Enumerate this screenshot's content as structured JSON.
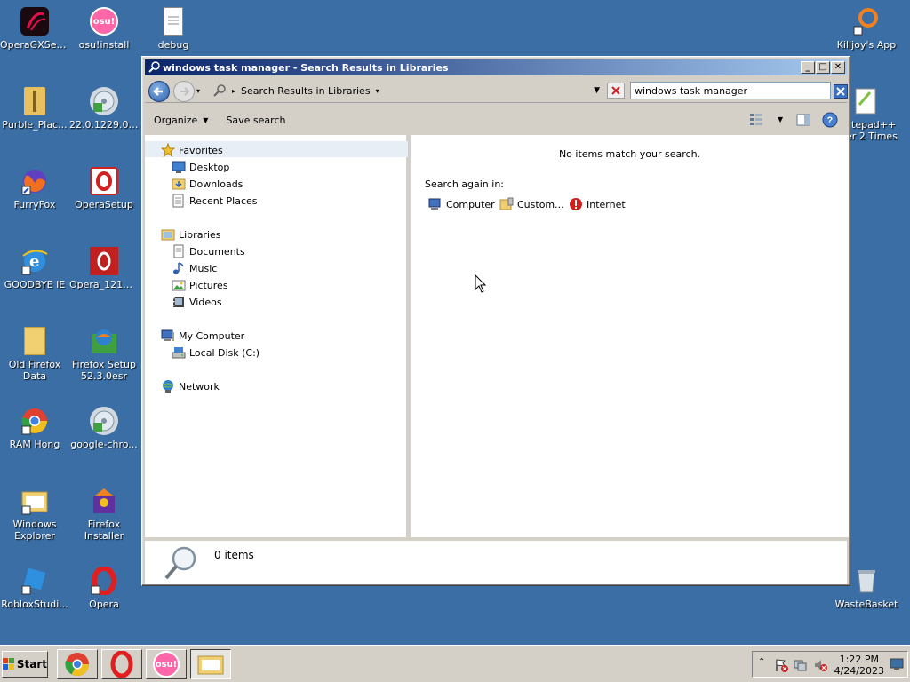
{
  "desktop": {
    "icons": [
      {
        "label": "OperaGXSetup",
        "icon": "opera-gx-icon",
        "color": "#b01030"
      },
      {
        "label": "osu!install",
        "icon": "osu-icon",
        "color": "#ff66aa"
      },
      {
        "label": "debug",
        "icon": "document-icon",
        "color": "#ffffff"
      },
      {
        "label": "Purble_Plac...",
        "icon": "zip-folder-icon",
        "color": "#e8c060"
      },
      {
        "label": "22.0.1229.0....",
        "icon": "installer-icon",
        "color": "#a0c0a0"
      },
      {
        "label": "FurryFox",
        "icon": "firefox-icon",
        "color": "#e86020"
      },
      {
        "label": "OperaSetup",
        "icon": "opera-setup-icon",
        "color": "#d02020"
      },
      {
        "label": "GOODBYE IE",
        "icon": "ie-icon",
        "color": "#2a80d0"
      },
      {
        "label": "Opera_1217....",
        "icon": "opera-package-icon",
        "color": "#c02020"
      },
      {
        "label": "Old Firefox Data",
        "icon": "folder-icon",
        "color": "#f0d070"
      },
      {
        "label": "Firefox Setup 52.3.0esr",
        "icon": "firefox-setup-icon",
        "color": "#40a040"
      },
      {
        "label": "RAM Hong",
        "icon": "chrome-icon",
        "color": "#e04030"
      },
      {
        "label": "google-chro...",
        "icon": "installer-icon",
        "color": "#a0c0a0"
      },
      {
        "label": "Windows Explorer",
        "icon": "explorer-icon",
        "color": "#f0d070"
      },
      {
        "label": "Firefox Installer",
        "icon": "firefox-installer-icon",
        "color": "#8040a0"
      },
      {
        "label": "RobloxStudi...",
        "icon": "roblox-studio-icon",
        "color": "#3090e0"
      },
      {
        "label": "Opera",
        "icon": "opera-icon",
        "color": "#e02020"
      },
      {
        "label": "Killjoy's App",
        "icon": "killjoy-icon",
        "color": "#f08020"
      },
      {
        "label": "tepad++",
        "icon": "notepadpp-icon",
        "color": "#80c040"
      },
      {
        "label": "er 2 Times",
        "icon": "",
        "color": ""
      },
      {
        "label": "WasteBasket",
        "icon": "recycle-bin-icon",
        "color": "#c0c8d0"
      }
    ]
  },
  "window": {
    "title": "windows task manager - Search Results in Libraries",
    "address": "Search Results in Libraries",
    "search_value": "windows task manager",
    "toolbar": {
      "organize": "Organize",
      "save_search": "Save search"
    },
    "nav": {
      "favorites": "Favorites",
      "favorites_items": [
        "Desktop",
        "Downloads",
        "Recent Places"
      ],
      "libraries": "Libraries",
      "libraries_items": [
        "Documents",
        "Music",
        "Pictures",
        "Videos"
      ],
      "computer": "My Computer",
      "computer_items": [
        "Local Disk (C:)"
      ],
      "network": "Network"
    },
    "content": {
      "no_items": "No items match your search.",
      "search_again": "Search again in:",
      "options": [
        "Computer",
        "Custom...",
        "Internet"
      ]
    },
    "details": {
      "count": "0 items"
    }
  },
  "taskbar": {
    "start": "Start",
    "apps": [
      "chrome-icon",
      "opera-icon",
      "osu-icon",
      "explorer-icon"
    ],
    "osu_label": "osu!",
    "time": "1:22 PM",
    "date": "4/24/2023"
  }
}
